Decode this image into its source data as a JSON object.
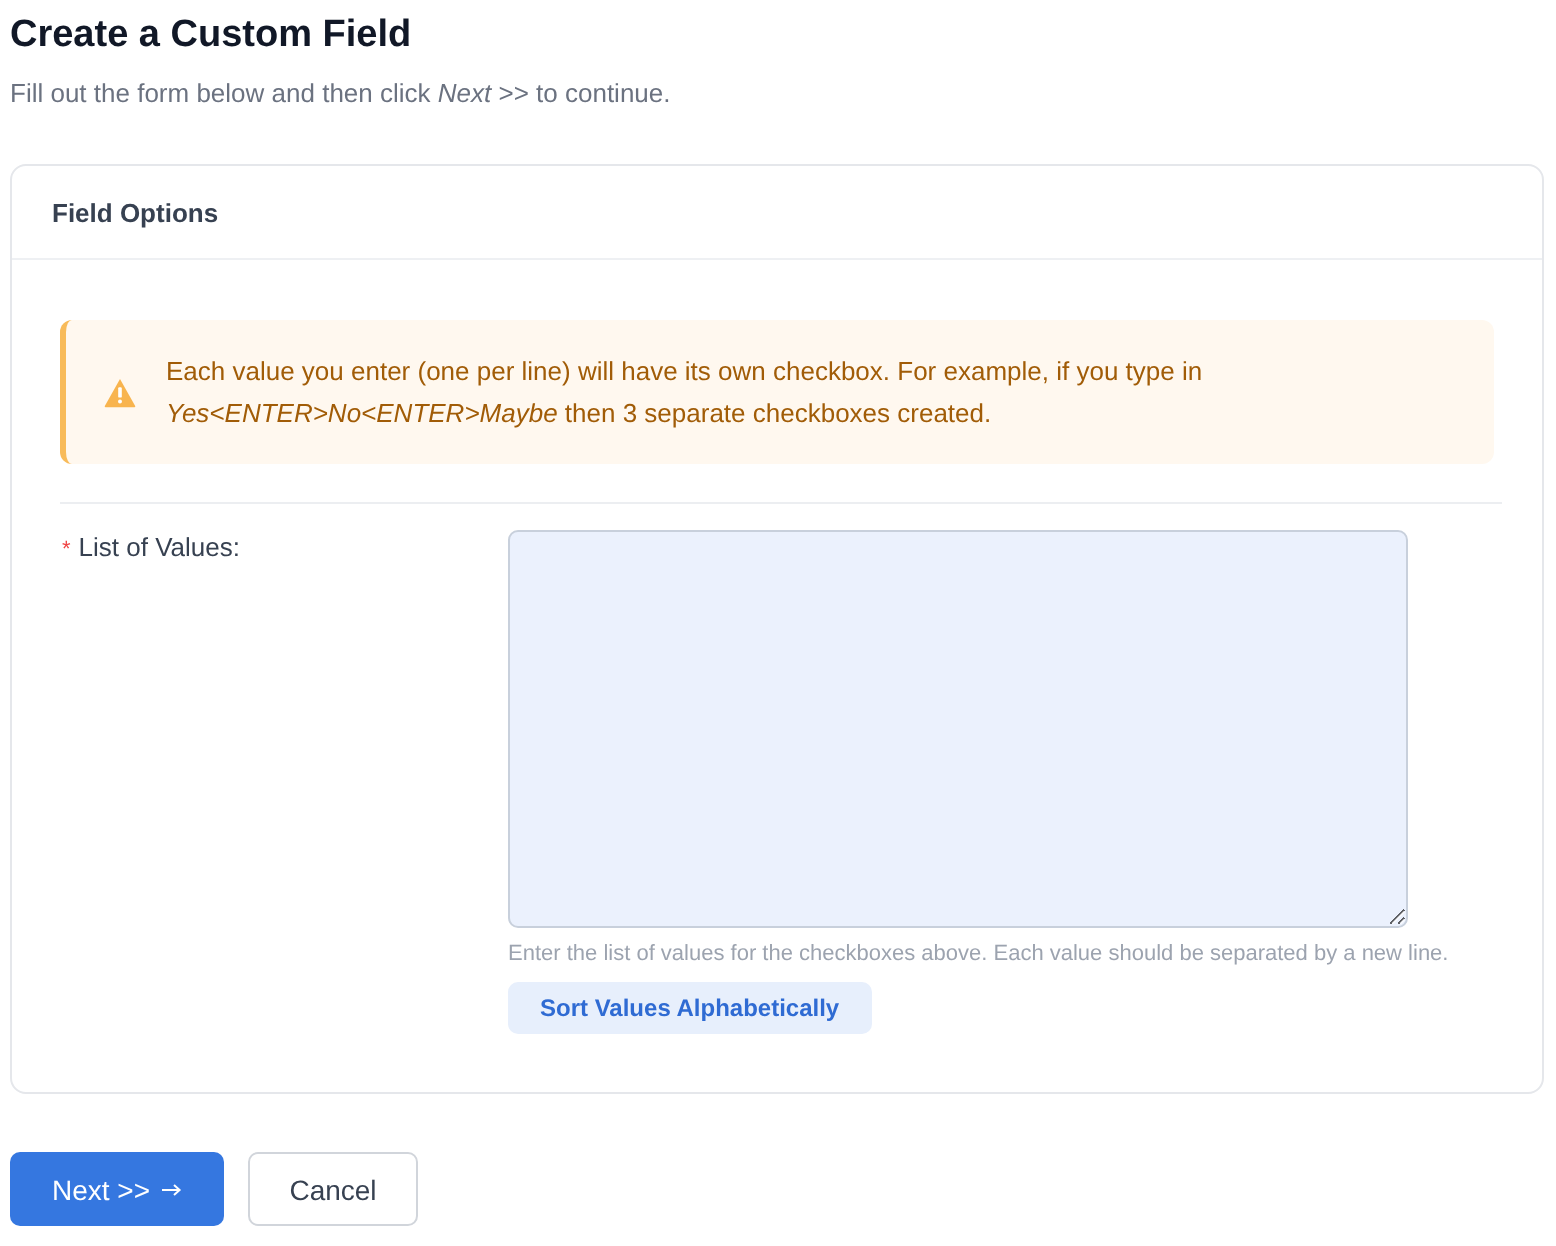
{
  "page": {
    "title": "Create a Custom Field",
    "subtitle": "Fill out the form below and then click *Next* >> to continue."
  },
  "card": {
    "title": "Field Options",
    "alert": {
      "kind": "warning",
      "text": "Each value you enter (one per line) will have its own checkbox. For example, if you type in *Yes<ENTER>No<ENTER>Maybe* then 3 separate checkboxes created."
    },
    "field": {
      "required_mark": "*",
      "label": "List of Values:",
      "help": "Enter the list of values for the checkboxes above. Each value should be separated by a new line.",
      "action": "Sort Values Alphabetically"
    }
  },
  "buttons": [
    {
      "kind": "primary",
      "label": "Next >>"
    },
    {
      "kind": "secondary",
      "label": "Cancel"
    }
  ]
}
